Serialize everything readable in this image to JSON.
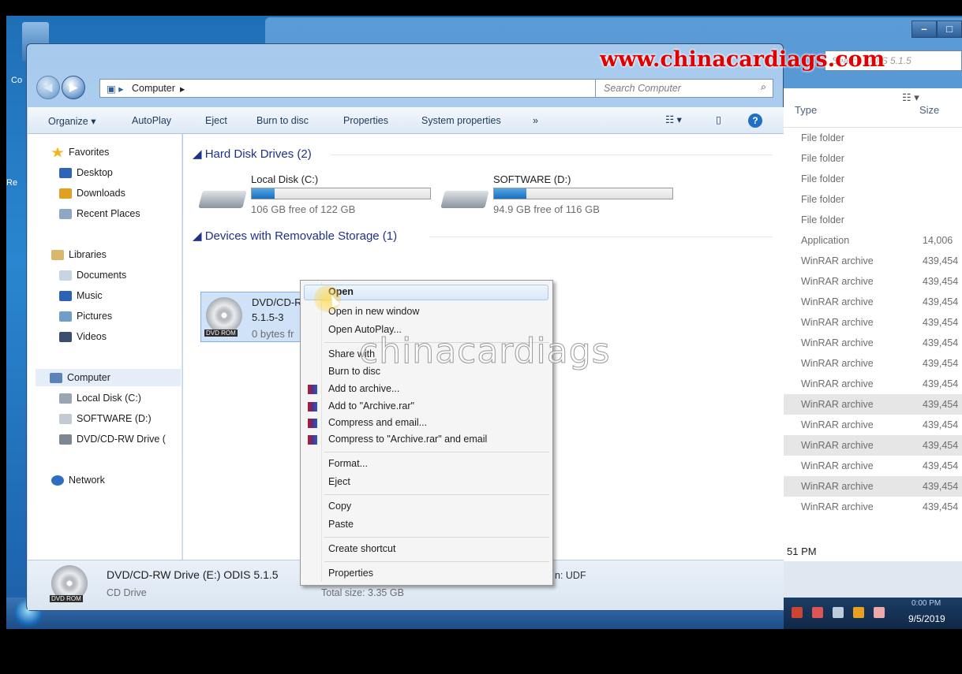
{
  "explorer": {
    "breadcrumb": "Computer",
    "search_placeholder": "Search Computer",
    "toolbar": [
      "Organize ▾",
      "AutoPlay",
      "Eject",
      "Burn to disc",
      "Properties",
      "System properties",
      "»"
    ],
    "nav": {
      "favorites": "Favorites",
      "desktop": "Desktop",
      "downloads": "Downloads",
      "recent": "Recent Places",
      "libraries": "Libraries",
      "documents": "Documents",
      "music": "Music",
      "pictures": "Pictures",
      "videos": "Videos",
      "computer": "Computer",
      "local_disk": "Local Disk (C:)",
      "software": "SOFTWARE (D:)",
      "dvd": "DVD/CD-RW Drive (",
      "network": "Network"
    },
    "groups": {
      "hdd": "Hard Disk Drives (2)",
      "removable": "Devices with Removable Storage (1)"
    },
    "drives": [
      {
        "name": "Local Disk (C:)",
        "free": "106 GB free of 122 GB",
        "used_fraction": 0.13
      },
      {
        "name": "SOFTWARE (D:)",
        "free": "94.9 GB free of 116 GB",
        "used_fraction": 0.18
      }
    ],
    "dvd": {
      "name_line1": "DVD/CD-RW Drive (E:) ODIS",
      "name_line2": "5.1.5-3",
      "free": "0 bytes fr",
      "tag": "DVD ROM"
    },
    "details": {
      "title": "DVD/CD-RW Drive (E:) ODIS 5.1.5",
      "type": "CD Drive",
      "filesystem": "n: UDF",
      "total": "Total size: 3.35 GB"
    }
  },
  "context_menu": {
    "items": [
      "Open",
      "Open in new window",
      "Open AutoPlay...",
      "Share with",
      "Burn to disc",
      "Add to archive...",
      "Add to \"Archive.rar\"",
      "Compress and email...",
      "Compress to \"Archive.rar\" and email",
      "Format...",
      "Eject",
      "Copy",
      "Paste",
      "Create shortcut",
      "Properties"
    ]
  },
  "background_window": {
    "search": "Search ODIS 5.1.5",
    "columns": {
      "type": "Type",
      "size": "Size"
    },
    "rows": [
      {
        "type": "File folder",
        "size": ""
      },
      {
        "type": "File folder",
        "size": ""
      },
      {
        "type": "File folder",
        "size": ""
      },
      {
        "type": "File folder",
        "size": ""
      },
      {
        "type": "File folder",
        "size": ""
      },
      {
        "type": "Application",
        "size": "14,006"
      },
      {
        "type": "WinRAR archive",
        "size": "439,454"
      },
      {
        "type": "WinRAR archive",
        "size": "439,454"
      },
      {
        "type": "WinRAR archive",
        "size": "439,454"
      },
      {
        "type": "WinRAR archive",
        "size": "439,454"
      },
      {
        "type": "WinRAR archive",
        "size": "439,454"
      },
      {
        "type": "WinRAR archive",
        "size": "439,454"
      },
      {
        "type": "WinRAR archive",
        "size": "439,454"
      },
      {
        "type": "WinRAR archive",
        "size": "439,454"
      },
      {
        "type": "WinRAR archive",
        "size": "439,454"
      },
      {
        "type": "WinRAR archive",
        "size": "439,454"
      },
      {
        "type": "WinRAR archive",
        "size": "439,454"
      },
      {
        "type": "WinRAR archive",
        "size": "439,454"
      },
      {
        "type": "WinRAR archive",
        "size": "439,454"
      }
    ],
    "status": "51 PM"
  },
  "tray": {
    "time": "0:00 PM",
    "date": "9/5/2019"
  },
  "desktop": {
    "label1": "Co",
    "label2": "Re"
  },
  "watermark": {
    "url": "www.chinacardiags.com",
    "center": "chinacardiags"
  }
}
